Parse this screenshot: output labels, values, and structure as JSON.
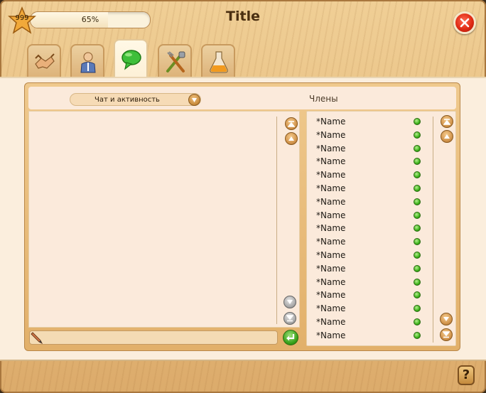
{
  "header": {
    "level": "999",
    "progress_text": "65%",
    "progress_value": 0.65,
    "title": "Title"
  },
  "tabs": [
    {
      "icon": "handshake-icon",
      "active": false
    },
    {
      "icon": "person-icon",
      "active": false
    },
    {
      "icon": "chat-bubble-icon",
      "active": true
    },
    {
      "icon": "tools-icon",
      "active": false
    },
    {
      "icon": "potion-icon",
      "active": false
    }
  ],
  "chat": {
    "dropdown_selected": "Чат и активность",
    "members_title": "Члены"
  },
  "members": [
    {
      "name": "*Name",
      "online": true
    },
    {
      "name": "*Name",
      "online": true
    },
    {
      "name": "*Name",
      "online": true
    },
    {
      "name": "*Name",
      "online": true
    },
    {
      "name": "*Name",
      "online": true
    },
    {
      "name": "*Name",
      "online": true
    },
    {
      "name": "*Name",
      "online": true
    },
    {
      "name": "*Name",
      "online": true
    },
    {
      "name": "*Name",
      "online": true
    },
    {
      "name": "*Name",
      "online": true
    },
    {
      "name": "*Name",
      "online": true
    },
    {
      "name": "*Name",
      "online": true
    },
    {
      "name": "*Name",
      "online": true
    },
    {
      "name": "*Name",
      "online": true
    },
    {
      "name": "*Name",
      "online": true
    },
    {
      "name": "*Name",
      "online": true
    },
    {
      "name": "*Name",
      "online": true
    }
  ],
  "footer": {
    "help_label": "?"
  },
  "colors": {
    "wood": "#e7bd7f",
    "panel": "#fbeadb",
    "accent_green": "#36a018",
    "close_red": "#e02a14"
  }
}
